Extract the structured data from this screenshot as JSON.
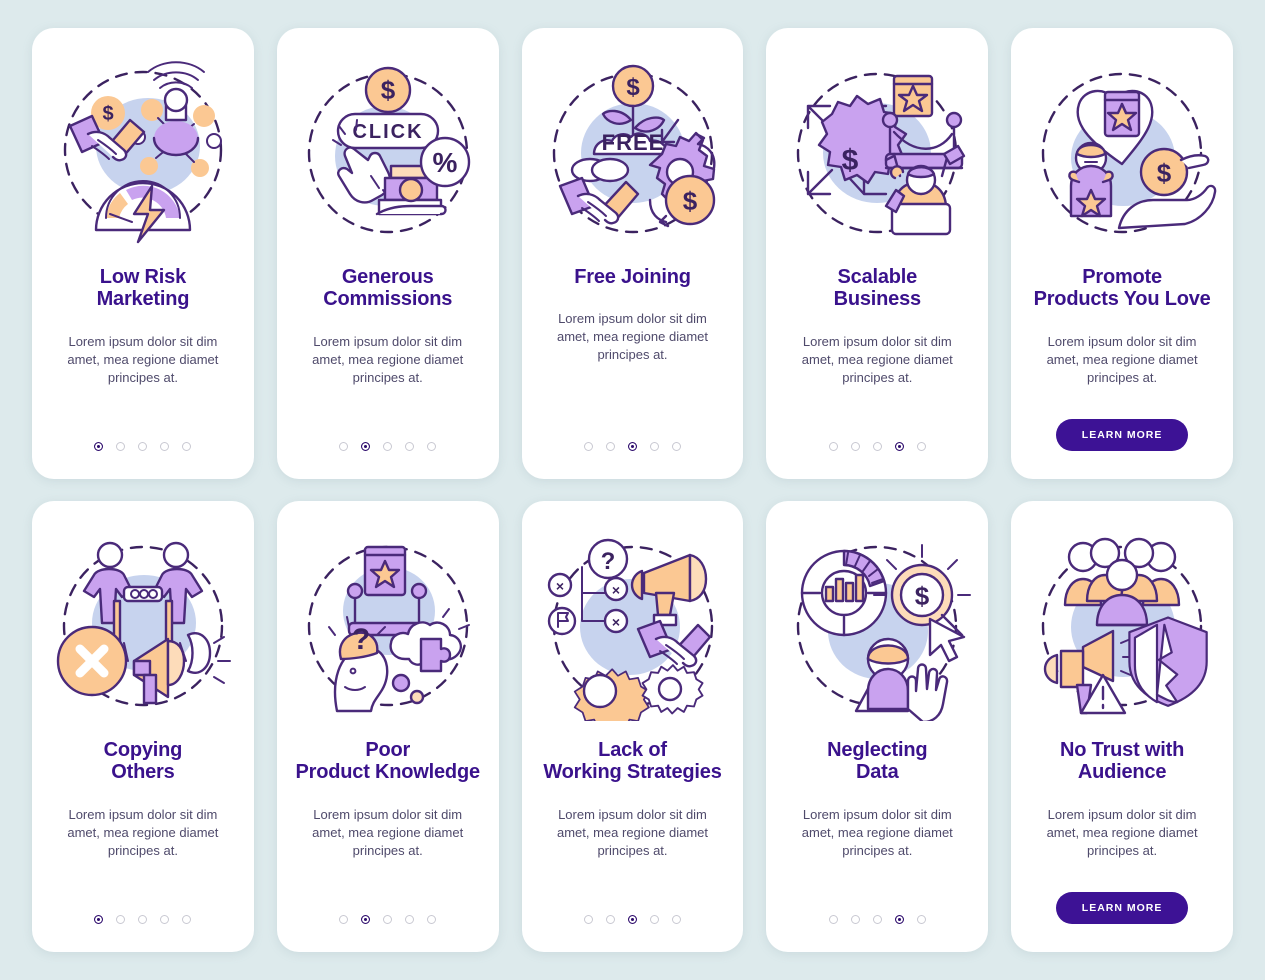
{
  "page": {
    "background_color": "#ddeaec",
    "card_background": "#ffffff",
    "title_color": "#3a128c",
    "body_color": "#4f4a6b",
    "cta_color": "#3d1295",
    "dot_active_color": "#2c0a6b",
    "dot_inactive_color": "#c9c9d2"
  },
  "lorem": "Lorem ipsum dolor sit dim\namet, mea regione diamet\nprincipes at.",
  "cta_label": "LEARN MORE",
  "illustration_text": {
    "click": "CLICK",
    "free": "FREE",
    "dollar": "$",
    "percent": "%",
    "question": "?",
    "cross": "×",
    "exclaim": "!"
  },
  "rows": [
    {
      "name": "benefits-row",
      "cards": [
        {
          "title": "Low Risk\nMarketing",
          "body": "Lorem ipsum dolor sit dim\namet, mea regione diamet\nprincipes at.",
          "illustration": "handshake-network-speedometer",
          "footer": "dots",
          "dots_total": 5,
          "dots_active": 1
        },
        {
          "title": "Generous\nCommissions",
          "body": "Lorem ipsum dolor sit dim\namet, mea regione diamet\nprincipes at.",
          "illustration": "click-coin-discount",
          "footer": "dots",
          "dots_total": 5,
          "dots_active": 2
        },
        {
          "title": "Free Joining",
          "body": "Lorem ipsum dolor sit dim\namet, mea regione diamet\nprincipes at.",
          "illustration": "free-plant-handshake-gear",
          "footer": "dots",
          "dots_total": 5,
          "dots_active": 3
        },
        {
          "title": "Scalable\nBusiness",
          "body": "Lorem ipsum dolor sit dim\namet, mea regione diamet\nprincipes at.",
          "illustration": "scale-gear-banner-person",
          "footer": "dots",
          "dots_total": 5,
          "dots_active": 4
        },
        {
          "title": "Promote\nProducts You Love",
          "body": "Lorem ipsum dolor sit dim\namet, mea regione diamet\nprincipes at.",
          "illustration": "heart-product-hand-coin",
          "footer": "button",
          "dots_total": 5,
          "dots_active": 5
        }
      ]
    },
    {
      "name": "mistakes-row",
      "cards": [
        {
          "title": "Copying\nOthers",
          "body": "Lorem ipsum dolor sit dim\namet, mea regione diamet\nprincipes at.",
          "illustration": "copy-people-cross-megaphone",
          "footer": "dots",
          "dots_total": 5,
          "dots_active": 1
        },
        {
          "title": "Poor\nProduct Knowledge",
          "body": "Lorem ipsum dolor sit dim\namet, mea regione diamet\nprincipes at.",
          "illustration": "confused-head-puzzle-cloud",
          "footer": "dots",
          "dots_total": 5,
          "dots_active": 2
        },
        {
          "title": "Lack of\nWorking Strategies",
          "body": "Lorem ipsum dolor sit dim\namet, mea regione diamet\nprincipes at.",
          "illustration": "strategy-question-gears-megaphone",
          "footer": "dots",
          "dots_total": 5,
          "dots_active": 3
        },
        {
          "title": "Neglecting\nData",
          "body": "Lorem ipsum dolor sit dim\namet, mea regione diamet\nprincipes at.",
          "illustration": "chart-magnifier-stop-warning",
          "footer": "dots",
          "dots_total": 5,
          "dots_active": 4
        },
        {
          "title": "No Trust with\nAudience",
          "body": "Lorem ipsum dolor sit dim\namet, mea regione diamet\nprincipes at.",
          "illustration": "crowd-megaphone-broken-shield",
          "footer": "button",
          "dots_total": 5,
          "dots_active": 5
        }
      ]
    }
  ]
}
